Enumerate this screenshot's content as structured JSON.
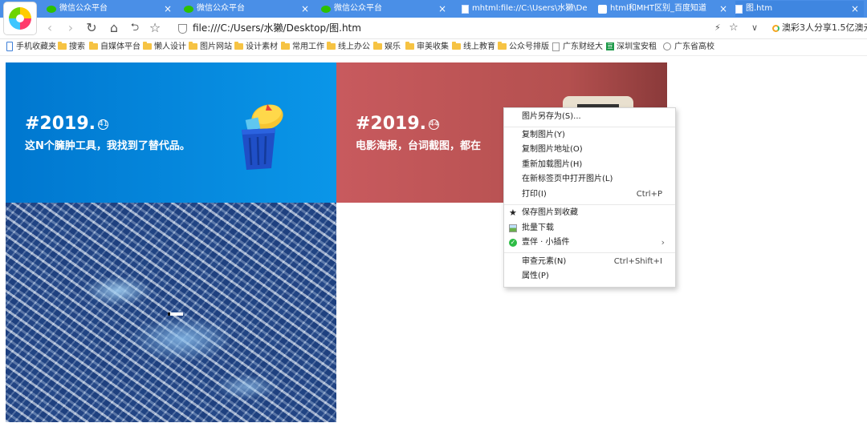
{
  "tabs": [
    {
      "label": "微信公众平台",
      "icon": "wechat-icon",
      "close": "×"
    },
    {
      "label": "微信公众平台",
      "icon": "wechat-icon",
      "close": "×"
    },
    {
      "label": "微信公众平台",
      "icon": "wechat-icon",
      "close": "×"
    },
    {
      "label": "mhtml:file://C:\\Users\\水獭\\De",
      "icon": "document-icon",
      "close": "×"
    },
    {
      "label": "html和MHT区别_百度知道",
      "icon": "baidu-icon",
      "close": "×"
    },
    {
      "label": "图.htm",
      "icon": "document-icon",
      "close": "×"
    }
  ],
  "toolbar": {
    "back": "‹",
    "forward": "›",
    "reload": "↻",
    "home": "⌂",
    "undo": "⮌",
    "star": "☆",
    "url": "file:///C:/Users/水獭/Desktop/图.htm",
    "lightning": "⚡",
    "star_right": "☆",
    "dropdown": "∨",
    "news": "澳彩3人分享1.5亿澳元"
  },
  "bookmarks": [
    {
      "label": "手机收藏夹",
      "icon": "phone-icon"
    },
    {
      "label": "搜索",
      "icon": "folder-icon"
    },
    {
      "label": "自媒体平台",
      "icon": "folder-icon"
    },
    {
      "label": "懒人设计",
      "icon": "folder-icon"
    },
    {
      "label": "图片网站",
      "icon": "folder-icon"
    },
    {
      "label": "设计素材",
      "icon": "folder-icon"
    },
    {
      "label": "常用工作",
      "icon": "folder-icon"
    },
    {
      "label": "线上办公",
      "icon": "folder-icon"
    },
    {
      "label": "娱乐",
      "icon": "folder-icon"
    },
    {
      "label": "审美收集",
      "icon": "folder-icon"
    },
    {
      "label": "线上教育",
      "icon": "folder-icon"
    },
    {
      "label": "公众号排版",
      "icon": "folder-icon"
    },
    {
      "label": "广东财经大",
      "icon": "page-icon"
    },
    {
      "label": "深圳宝安租",
      "icon": "green-site-icon"
    },
    {
      "label": "广东省高校",
      "icon": "globe-icon"
    }
  ],
  "banners": [
    {
      "title": "#2019.",
      "badge": "41",
      "subtitle": "这N个臃肿工具，我找到了替代品。"
    },
    {
      "title": "#2019.",
      "badge": "44",
      "subtitle": "电影海报，台词截图，都在"
    }
  ],
  "context_menu": [
    {
      "label": "图片另存为(S)...",
      "shortcut": ""
    },
    {
      "label": "复制图片(Y)",
      "shortcut": ""
    },
    {
      "label": "复制图片地址(O)",
      "shortcut": ""
    },
    {
      "label": "重新加载图片(H)",
      "shortcut": ""
    },
    {
      "label": "在新标签页中打开图片(L)",
      "shortcut": ""
    },
    {
      "label": "打印(I)",
      "shortcut": "Ctrl+P"
    },
    {
      "label": "保存图片到收藏",
      "shortcut": "",
      "icon": "star-icon"
    },
    {
      "label": "批量下载",
      "shortcut": "",
      "icon": "image-icon"
    },
    {
      "label": "壹伴 · 小插件",
      "shortcut": "",
      "icon": "yiban-icon",
      "submenu": "›"
    },
    {
      "label": "审查元素(N)",
      "shortcut": "Ctrl+Shift+I"
    },
    {
      "label": "属性(P)",
      "shortcut": ""
    }
  ],
  "colors": {
    "tabbar": "#4a8fe7",
    "banner_blue": "#0a8be0",
    "banner_red": "#c25658"
  }
}
